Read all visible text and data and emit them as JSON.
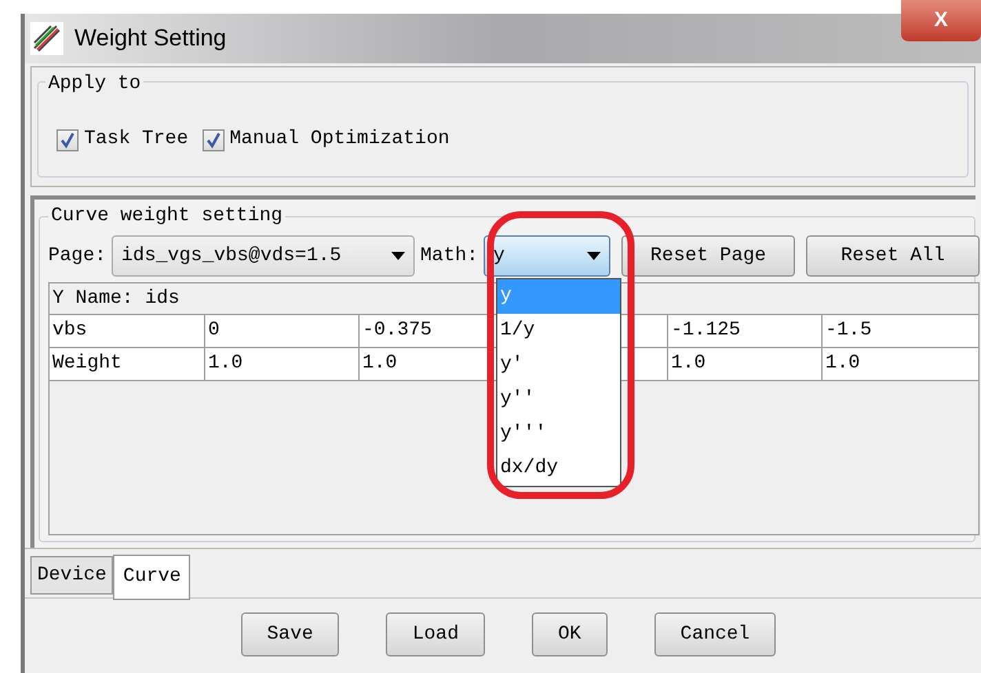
{
  "window": {
    "title": "Weight Setting",
    "close": "X"
  },
  "apply_to": {
    "title": "Apply to",
    "options": [
      {
        "label": "Task Tree",
        "checked": true
      },
      {
        "label": "Manual Optimization",
        "checked": true
      }
    ]
  },
  "curve": {
    "title": "Curve weight setting",
    "page_label": "Page:",
    "page_value": "ids_vgs_vbs@vds=1.5",
    "math_label": "Math:",
    "math_value": "y",
    "math_options": [
      {
        "label": "y",
        "selected": true
      },
      {
        "label": "1/y",
        "selected": false
      },
      {
        "label": "y'",
        "selected": false
      },
      {
        "label": "y''",
        "selected": false
      },
      {
        "label": "y'''",
        "selected": false
      },
      {
        "label": "dx/dy",
        "selected": false
      }
    ],
    "buttons": [
      "Reset Page",
      "Reset All"
    ],
    "y_name": "Y Name: ids",
    "rows": [
      [
        "vbs",
        "0",
        "-0.375",
        null,
        "-1.125",
        "-1.5"
      ],
      [
        "Weight",
        "1.0",
        "1.0",
        null,
        "1.0",
        "1.0"
      ]
    ]
  },
  "tabs": [
    {
      "label": "Device",
      "selected": false
    },
    {
      "label": "Curve",
      "selected": true
    }
  ],
  "buttons": [
    "Save",
    "Load",
    "OK",
    "Cancel"
  ]
}
